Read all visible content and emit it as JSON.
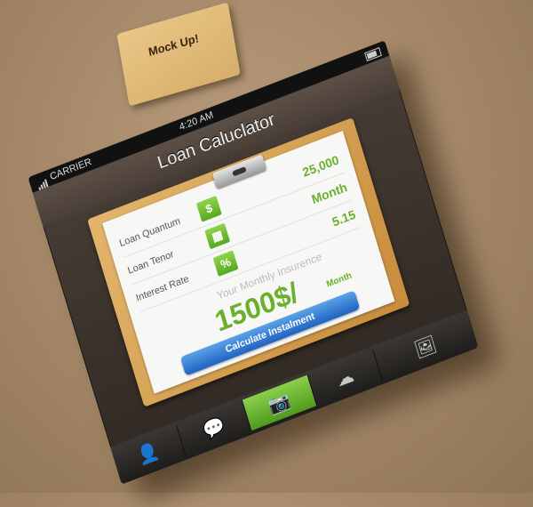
{
  "statusbar": {
    "carrier": "CARRIER",
    "time": "4:20 AM"
  },
  "navbar": {
    "title": "Loan Caluclator"
  },
  "mock_note": {
    "label": "Mock Up!"
  },
  "form": {
    "rows": [
      {
        "label": "Loan Quantum",
        "icon": "$",
        "icon_name": "dollar-icon",
        "value": "25,000"
      },
      {
        "label": "Loan Tenor",
        "icon": "▦",
        "icon_name": "calendar-icon",
        "value": "Month"
      },
      {
        "label": "Interest Rate",
        "icon": "%",
        "icon_name": "percent-icon",
        "value": "5.15"
      }
    ],
    "insurance_label": "Your Monthly Insurence",
    "amount": "1500$/",
    "amount_unit": "Month",
    "calc_button": "Calculate Instalment"
  },
  "tabbar": {
    "tabs": [
      {
        "name": "profile",
        "glyph": "👤",
        "active": false
      },
      {
        "name": "chat",
        "glyph": "💬",
        "active": false
      },
      {
        "name": "camera",
        "glyph": "📷",
        "active": true
      },
      {
        "name": "cloud",
        "glyph": "☁",
        "active": false
      },
      {
        "name": "gallery",
        "glyph": "🖼",
        "active": false
      }
    ]
  },
  "colors": {
    "accent_green": "#6ab02c",
    "button_blue": "#2f78d0",
    "background": "#a68a6a"
  }
}
